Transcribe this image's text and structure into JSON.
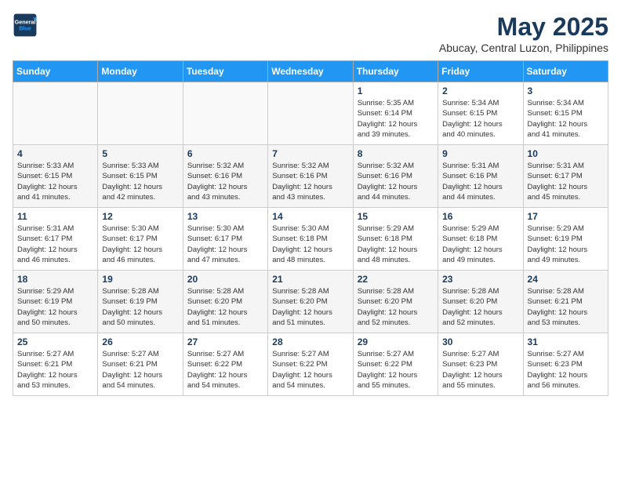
{
  "logo": {
    "line1": "General",
    "line2": "Blue"
  },
  "title": "May 2025",
  "subtitle": "Abucay, Central Luzon, Philippines",
  "days_of_week": [
    "Sunday",
    "Monday",
    "Tuesday",
    "Wednesday",
    "Thursday",
    "Friday",
    "Saturday"
  ],
  "weeks": [
    [
      {
        "day": "",
        "info": ""
      },
      {
        "day": "",
        "info": ""
      },
      {
        "day": "",
        "info": ""
      },
      {
        "day": "",
        "info": ""
      },
      {
        "day": "1",
        "info": "Sunrise: 5:35 AM\nSunset: 6:14 PM\nDaylight: 12 hours\nand 39 minutes."
      },
      {
        "day": "2",
        "info": "Sunrise: 5:34 AM\nSunset: 6:15 PM\nDaylight: 12 hours\nand 40 minutes."
      },
      {
        "day": "3",
        "info": "Sunrise: 5:34 AM\nSunset: 6:15 PM\nDaylight: 12 hours\nand 41 minutes."
      }
    ],
    [
      {
        "day": "4",
        "info": "Sunrise: 5:33 AM\nSunset: 6:15 PM\nDaylight: 12 hours\nand 41 minutes."
      },
      {
        "day": "5",
        "info": "Sunrise: 5:33 AM\nSunset: 6:15 PM\nDaylight: 12 hours\nand 42 minutes."
      },
      {
        "day": "6",
        "info": "Sunrise: 5:32 AM\nSunset: 6:16 PM\nDaylight: 12 hours\nand 43 minutes."
      },
      {
        "day": "7",
        "info": "Sunrise: 5:32 AM\nSunset: 6:16 PM\nDaylight: 12 hours\nand 43 minutes."
      },
      {
        "day": "8",
        "info": "Sunrise: 5:32 AM\nSunset: 6:16 PM\nDaylight: 12 hours\nand 44 minutes."
      },
      {
        "day": "9",
        "info": "Sunrise: 5:31 AM\nSunset: 6:16 PM\nDaylight: 12 hours\nand 44 minutes."
      },
      {
        "day": "10",
        "info": "Sunrise: 5:31 AM\nSunset: 6:17 PM\nDaylight: 12 hours\nand 45 minutes."
      }
    ],
    [
      {
        "day": "11",
        "info": "Sunrise: 5:31 AM\nSunset: 6:17 PM\nDaylight: 12 hours\nand 46 minutes."
      },
      {
        "day": "12",
        "info": "Sunrise: 5:30 AM\nSunset: 6:17 PM\nDaylight: 12 hours\nand 46 minutes."
      },
      {
        "day": "13",
        "info": "Sunrise: 5:30 AM\nSunset: 6:17 PM\nDaylight: 12 hours\nand 47 minutes."
      },
      {
        "day": "14",
        "info": "Sunrise: 5:30 AM\nSunset: 6:18 PM\nDaylight: 12 hours\nand 48 minutes."
      },
      {
        "day": "15",
        "info": "Sunrise: 5:29 AM\nSunset: 6:18 PM\nDaylight: 12 hours\nand 48 minutes."
      },
      {
        "day": "16",
        "info": "Sunrise: 5:29 AM\nSunset: 6:18 PM\nDaylight: 12 hours\nand 49 minutes."
      },
      {
        "day": "17",
        "info": "Sunrise: 5:29 AM\nSunset: 6:19 PM\nDaylight: 12 hours\nand 49 minutes."
      }
    ],
    [
      {
        "day": "18",
        "info": "Sunrise: 5:29 AM\nSunset: 6:19 PM\nDaylight: 12 hours\nand 50 minutes."
      },
      {
        "day": "19",
        "info": "Sunrise: 5:28 AM\nSunset: 6:19 PM\nDaylight: 12 hours\nand 50 minutes."
      },
      {
        "day": "20",
        "info": "Sunrise: 5:28 AM\nSunset: 6:20 PM\nDaylight: 12 hours\nand 51 minutes."
      },
      {
        "day": "21",
        "info": "Sunrise: 5:28 AM\nSunset: 6:20 PM\nDaylight: 12 hours\nand 51 minutes."
      },
      {
        "day": "22",
        "info": "Sunrise: 5:28 AM\nSunset: 6:20 PM\nDaylight: 12 hours\nand 52 minutes."
      },
      {
        "day": "23",
        "info": "Sunrise: 5:28 AM\nSunset: 6:20 PM\nDaylight: 12 hours\nand 52 minutes."
      },
      {
        "day": "24",
        "info": "Sunrise: 5:28 AM\nSunset: 6:21 PM\nDaylight: 12 hours\nand 53 minutes."
      }
    ],
    [
      {
        "day": "25",
        "info": "Sunrise: 5:27 AM\nSunset: 6:21 PM\nDaylight: 12 hours\nand 53 minutes."
      },
      {
        "day": "26",
        "info": "Sunrise: 5:27 AM\nSunset: 6:21 PM\nDaylight: 12 hours\nand 54 minutes."
      },
      {
        "day": "27",
        "info": "Sunrise: 5:27 AM\nSunset: 6:22 PM\nDaylight: 12 hours\nand 54 minutes."
      },
      {
        "day": "28",
        "info": "Sunrise: 5:27 AM\nSunset: 6:22 PM\nDaylight: 12 hours\nand 54 minutes."
      },
      {
        "day": "29",
        "info": "Sunrise: 5:27 AM\nSunset: 6:22 PM\nDaylight: 12 hours\nand 55 minutes."
      },
      {
        "day": "30",
        "info": "Sunrise: 5:27 AM\nSunset: 6:23 PM\nDaylight: 12 hours\nand 55 minutes."
      },
      {
        "day": "31",
        "info": "Sunrise: 5:27 AM\nSunset: 6:23 PM\nDaylight: 12 hours\nand 56 minutes."
      }
    ]
  ]
}
